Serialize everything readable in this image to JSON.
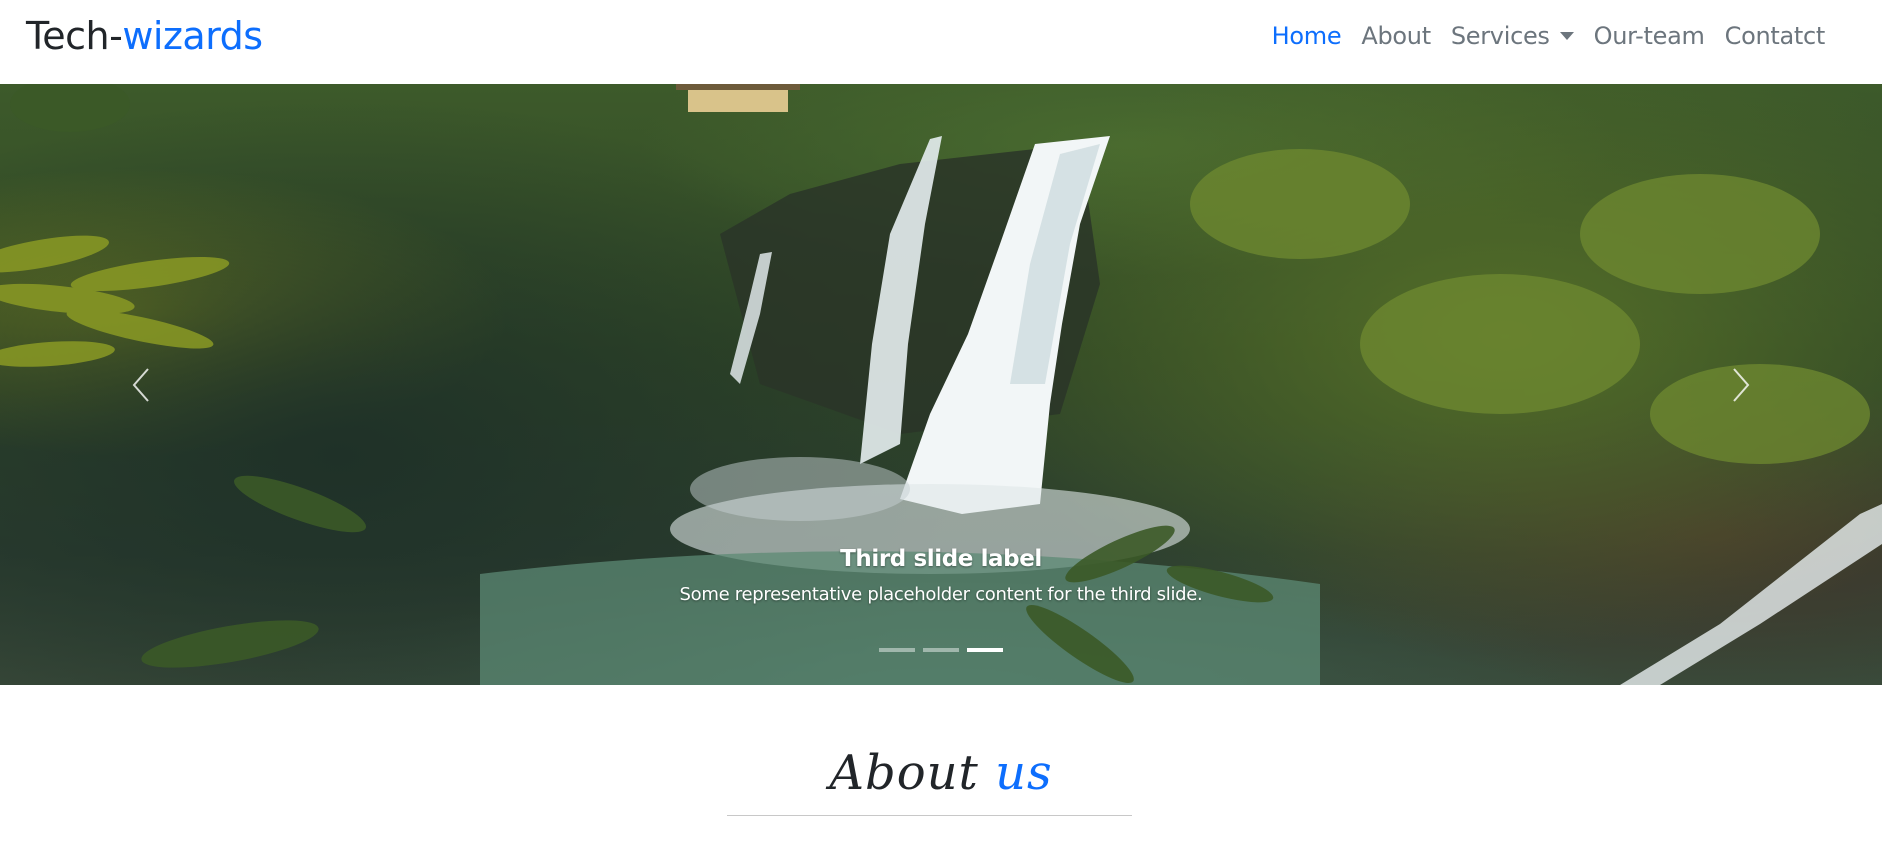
{
  "brand": {
    "part1": "Tech-",
    "part2": "wizards"
  },
  "nav": {
    "items": [
      "Home",
      "About",
      "Services",
      "Our-team",
      "Contatct"
    ],
    "active": "Home"
  },
  "carousel": {
    "caption_title": "Third slide label",
    "caption_text": "Some representative placeholder content for the third slide.",
    "slide_count": 3,
    "active_index": 3,
    "prev_icon": "chevron-left-icon",
    "next_icon": "chevron-right-icon"
  },
  "about": {
    "title_part1": "About ",
    "title_part2": "us"
  },
  "colors": {
    "accent": "#0d6efd",
    "text": "#212529",
    "muted": "#6c757d"
  }
}
